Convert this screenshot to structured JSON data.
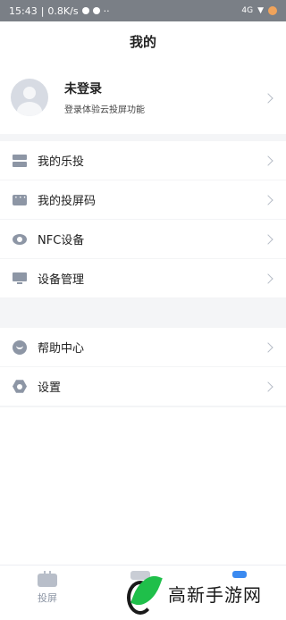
{
  "status_bar": {
    "time": "15:43",
    "speed": "0.8K/s",
    "right_badge": "4G"
  },
  "header": {
    "title": "我的"
  },
  "profile": {
    "name": "未登录",
    "subtitle": "登录体验云投屏功能"
  },
  "menu_group_1": [
    {
      "label": "我的乐投",
      "icon": "stack-icon"
    },
    {
      "label": "我的投屏码",
      "icon": "code-icon"
    },
    {
      "label": "NFC设备",
      "icon": "nfc-icon"
    },
    {
      "label": "设备管理",
      "icon": "monitor-icon"
    }
  ],
  "menu_group_2": [
    {
      "label": "帮助中心",
      "icon": "help-icon"
    },
    {
      "label": "设置",
      "icon": "settings-icon"
    }
  ],
  "tabbar": {
    "cast_label": "投屏"
  },
  "watermark": {
    "text": "高新手游网"
  },
  "colors": {
    "icon_gray": "#8d96a5",
    "accent_blue": "#3b8af0",
    "watermark_green": "#1fbf4a"
  }
}
